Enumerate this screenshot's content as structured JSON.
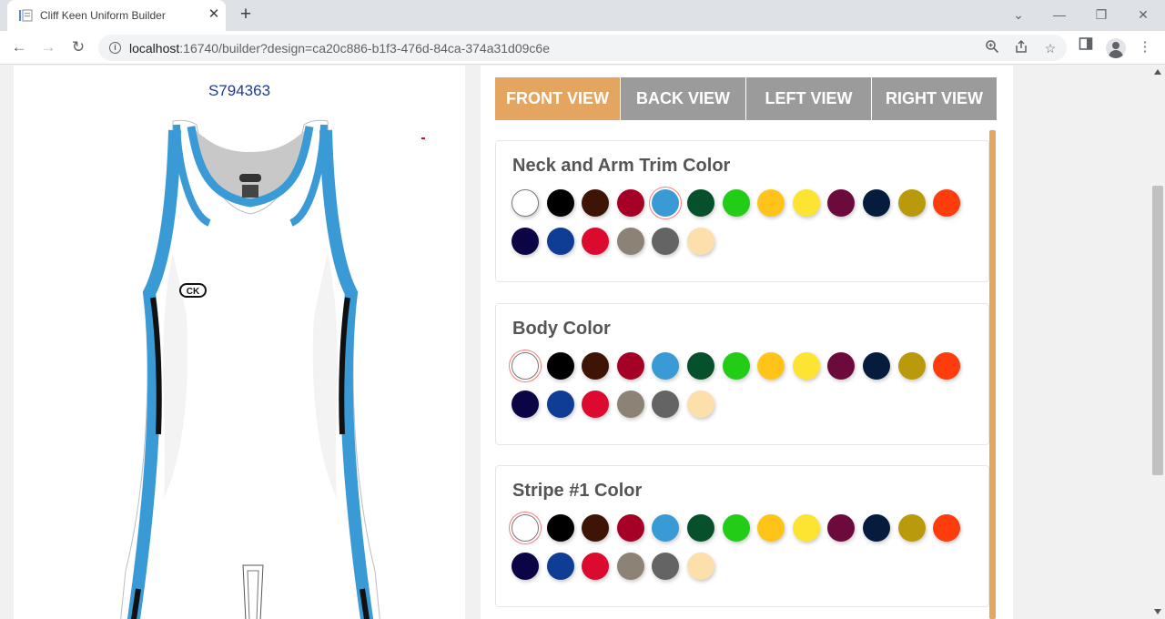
{
  "browser": {
    "tab_title": "Cliff Keen Uniform Builder",
    "url_host": "localhost",
    "url_rest": ":16740/builder?design=ca20c886-b1f3-476d-84ca-374a31d09c6e"
  },
  "preview": {
    "design_code": "S794363",
    "brand_mark": "CK",
    "colors": {
      "trim": "#3a9ad6",
      "body": "#ffffff",
      "stripe": "#111111",
      "neck_fill": "#c8c8c8"
    }
  },
  "view_tabs": [
    {
      "label": "FRONT VIEW",
      "active": true
    },
    {
      "label": "BACK VIEW",
      "active": false
    },
    {
      "label": "LEFT VIEW",
      "active": false
    },
    {
      "label": "RIGHT VIEW",
      "active": false
    }
  ],
  "palette": [
    "#ffffff",
    "#000000",
    "#3d1406",
    "#a50025",
    "#3a9ad6",
    "#06502b",
    "#22cc17",
    "#ffc417",
    "#fde433",
    "#6d0a3c",
    "#051c3c",
    "#b89a0a",
    "#ff3c0c",
    "#0b0546",
    "#0f3c94",
    "#dd0a30",
    "#8c8276",
    "#646464",
    "#fcdfab"
  ],
  "sections": [
    {
      "title": "Neck and Arm Trim Color",
      "selected_index": 4
    },
    {
      "title": "Body Color",
      "selected_index": 0
    },
    {
      "title": "Stripe #1 Color",
      "selected_index": 0
    }
  ]
}
